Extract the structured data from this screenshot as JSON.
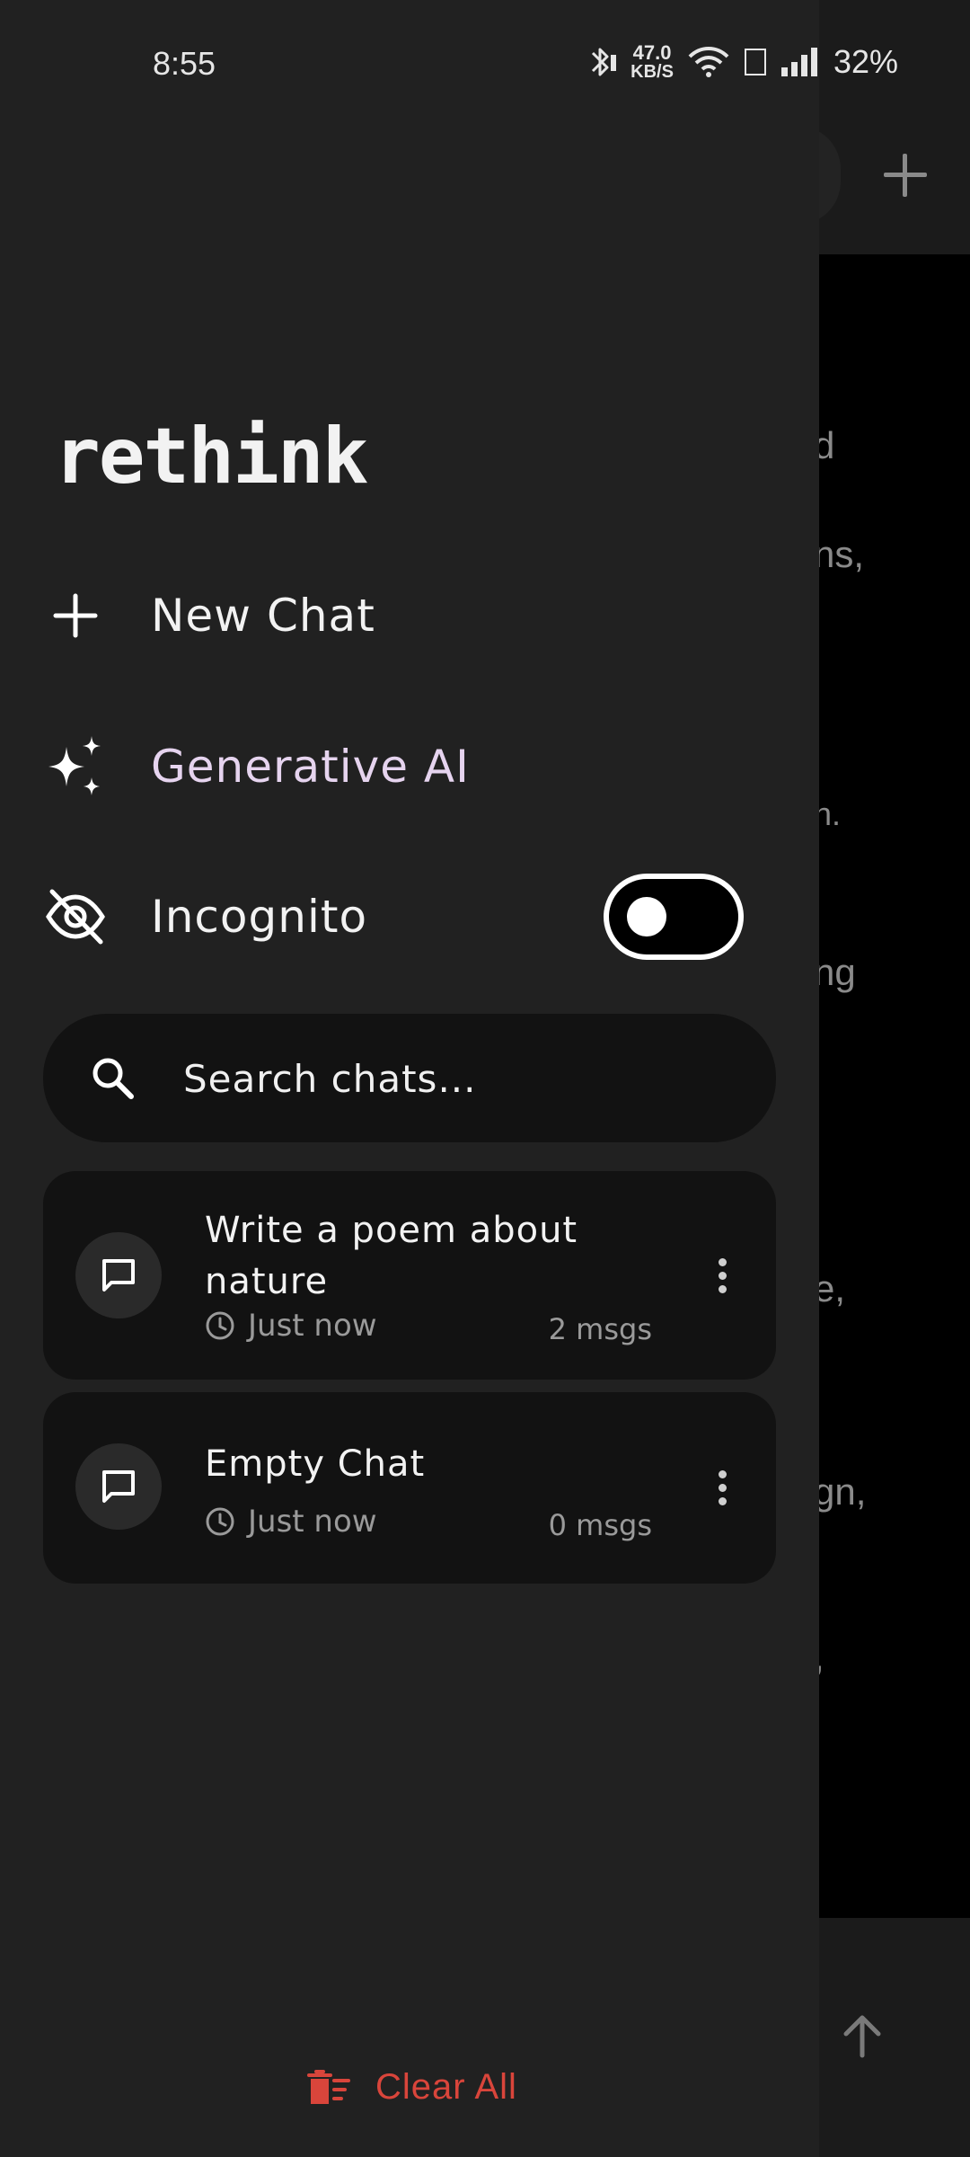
{
  "status_bar": {
    "time": "8:55",
    "net_speed_value": "47.0",
    "net_speed_unit": "KB/S",
    "battery": "32%"
  },
  "background": {
    "fragments": [
      "d",
      "ns,",
      "n.",
      "ng",
      "e,",
      "gn,",
      ","
    ]
  },
  "drawer": {
    "logo": "rethink",
    "menu": {
      "new_chat": "New Chat",
      "generative_ai": "Generative AI",
      "incognito": "Incognito"
    },
    "incognito_enabled": false,
    "search_placeholder": "Search chats...",
    "chats": [
      {
        "title": "Write a poem about nature",
        "time": "Just now",
        "count": "2 msgs"
      },
      {
        "title": "Empty Chat",
        "time": "Just now",
        "count": "0 msgs"
      }
    ],
    "clear_all": "Clear All"
  },
  "colors": {
    "drawer_bg": "#212121",
    "card_bg": "#121212",
    "danger": "#d9453b",
    "accent_text": "#e6d4ef"
  }
}
